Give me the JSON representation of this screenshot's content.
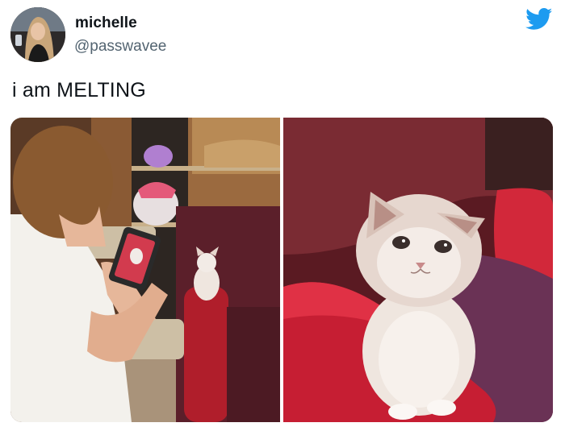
{
  "author": {
    "display_name": "michelle",
    "handle": "@passwavee",
    "avatar_icon": "profile-photo"
  },
  "platform_icon": "twitter-bird-icon",
  "colors": {
    "brand": "#1d9bf0",
    "name": "#0f1419",
    "handle": "#536471"
  },
  "tweet": {
    "text": "i am MELTING"
  },
  "media": {
    "photos": [
      {
        "subject": "person-photographing-kitten"
      },
      {
        "subject": "kitten-on-red-chair"
      }
    ]
  }
}
